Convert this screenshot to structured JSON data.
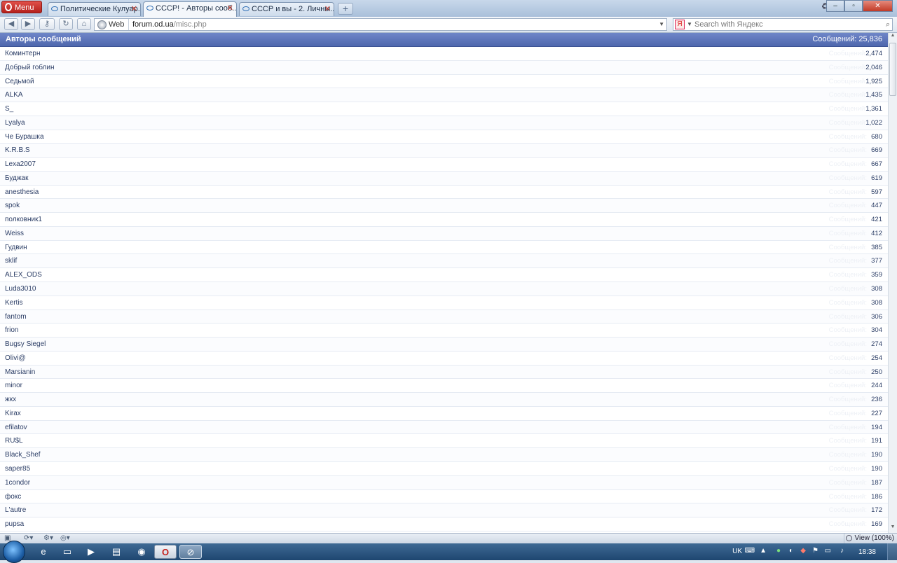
{
  "browser": {
    "menu_label": "Menu",
    "tabs": [
      {
        "title": "Политические Кулуар..."
      },
      {
        "title": "СССР! - Авторы сооб..."
      },
      {
        "title": "СССР и вы - 2. Личны..."
      }
    ],
    "address": {
      "scheme_label": "Web",
      "host": "forum.od.ua",
      "path": "/misc.php"
    },
    "search_placeholder": "Search with Яндекс",
    "search_engine_badge": "Я"
  },
  "page": {
    "header_title": "Авторы сообщений",
    "header_count": "Сообщений: 25,836",
    "row_label": "Сообщений:",
    "rows": [
      {
        "name": "Коминтерн",
        "count": "2,474"
      },
      {
        "name": "Добрый гоблин",
        "count": "2,046"
      },
      {
        "name": "Седьмой",
        "count": "1,925"
      },
      {
        "name": "ALKA",
        "count": "1,435"
      },
      {
        "name": "S_",
        "count": "1,361"
      },
      {
        "name": "Lyalya",
        "count": "1,022"
      },
      {
        "name": "Че Бурашка",
        "count": "680"
      },
      {
        "name": "K.R.B.S",
        "count": "669"
      },
      {
        "name": "Lexa2007",
        "count": "667"
      },
      {
        "name": "Буджак",
        "count": "619"
      },
      {
        "name": "anesthesia",
        "count": "597"
      },
      {
        "name": "spok",
        "count": "447"
      },
      {
        "name": "полковник1",
        "count": "421"
      },
      {
        "name": "Weiss",
        "count": "412"
      },
      {
        "name": "Гудвин",
        "count": "385"
      },
      {
        "name": "sklif",
        "count": "377"
      },
      {
        "name": "ALEX_ODS",
        "count": "359"
      },
      {
        "name": "Luda3010",
        "count": "308"
      },
      {
        "name": "Kertis",
        "count": "308"
      },
      {
        "name": "fantom",
        "count": "306"
      },
      {
        "name": "frion",
        "count": "304"
      },
      {
        "name": "Bugsy Siegel",
        "count": "274"
      },
      {
        "name": "Olivi@",
        "count": "254"
      },
      {
        "name": "Marsianin",
        "count": "250"
      },
      {
        "name": "minor",
        "count": "244"
      },
      {
        "name": "жкх",
        "count": "236"
      },
      {
        "name": "Kirax",
        "count": "227"
      },
      {
        "name": "efilatov",
        "count": "194"
      },
      {
        "name": "RU$L",
        "count": "191"
      },
      {
        "name": "Black_Shef",
        "count": "190"
      },
      {
        "name": "saper85",
        "count": "190"
      },
      {
        "name": "1condor",
        "count": "187"
      },
      {
        "name": "фокс",
        "count": "186"
      },
      {
        "name": "L'autre",
        "count": "172"
      },
      {
        "name": "pupsa",
        "count": "169"
      }
    ]
  },
  "status": {
    "zoom_label": "View (100%)"
  },
  "taskbar": {
    "language": "UK",
    "time": "18:38"
  }
}
